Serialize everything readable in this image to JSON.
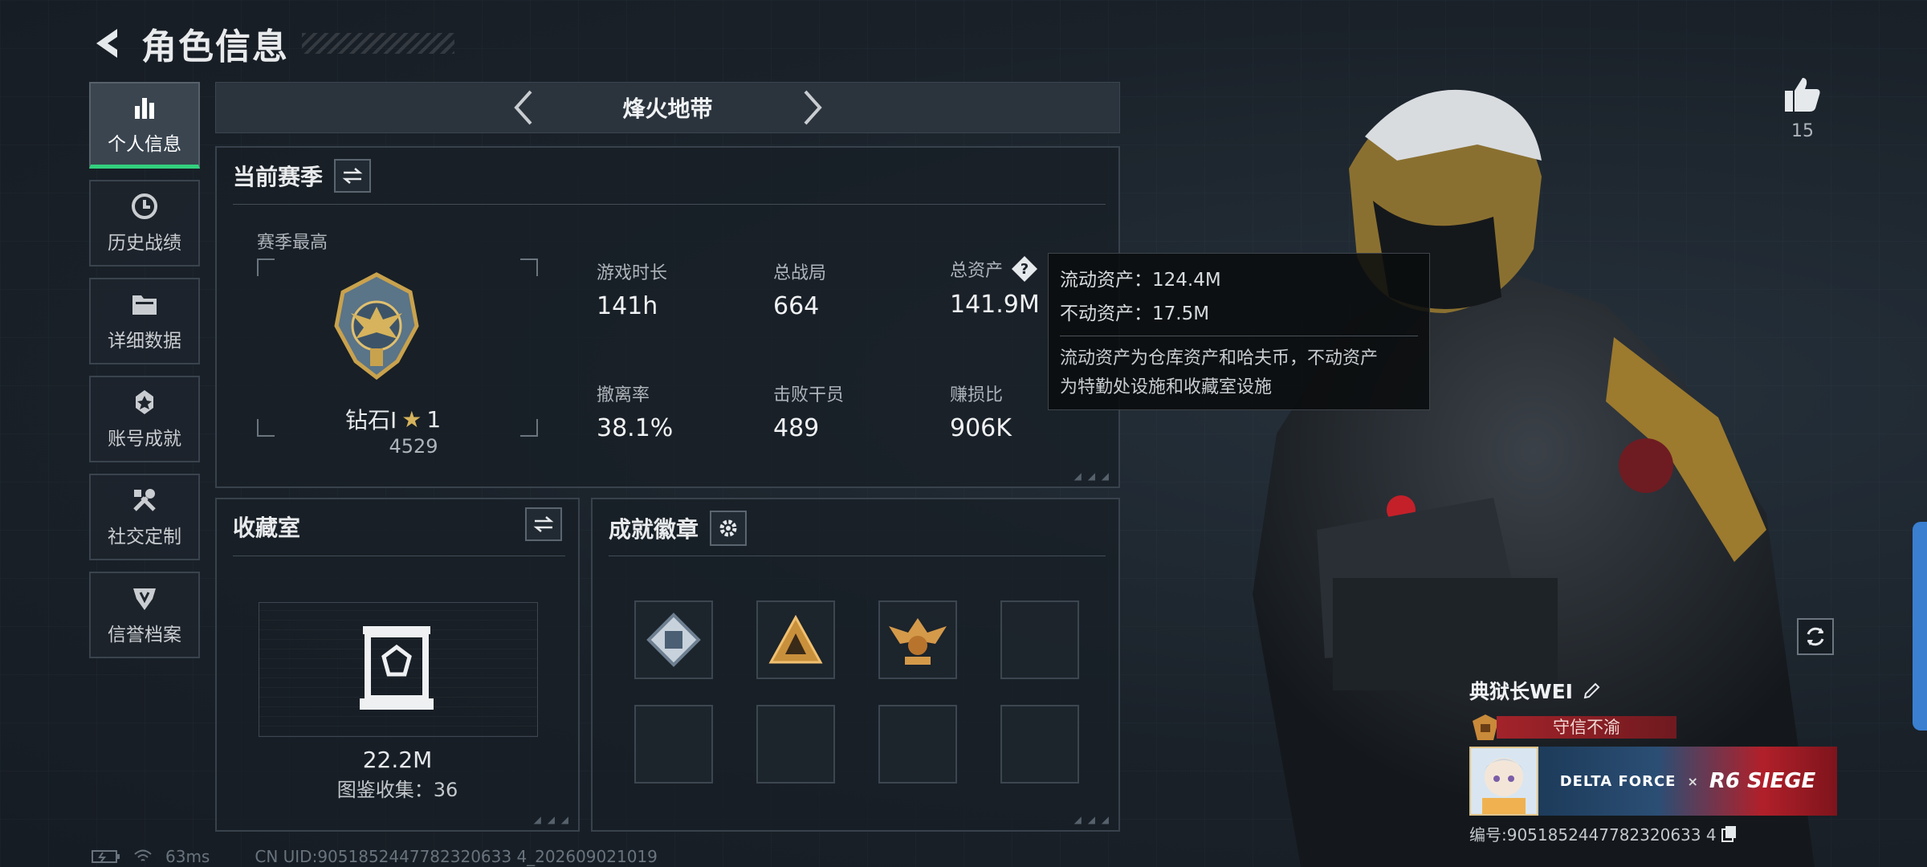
{
  "header": {
    "title": "角色信息"
  },
  "nav": {
    "items": [
      {
        "label": "个人信息",
        "icon": "bar-chart-icon",
        "active": true
      },
      {
        "label": "历史战绩",
        "icon": "history-clock-icon",
        "active": false
      },
      {
        "label": "详细数据",
        "icon": "folder-icon",
        "active": false
      },
      {
        "label": "账号成就",
        "icon": "achievement-icon",
        "active": false
      },
      {
        "label": "社交定制",
        "icon": "tools-icon",
        "active": false
      },
      {
        "label": "信誉档案",
        "icon": "shield-badge-icon",
        "active": false
      }
    ]
  },
  "mode": {
    "title": "烽火地带"
  },
  "season": {
    "title": "当前赛季",
    "best_label": "赛季最高",
    "rank_name": "钻石Ⅰ",
    "rank_stars": "1",
    "rank_score": "4529",
    "stats": [
      {
        "label": "游戏时长",
        "value": "141h"
      },
      {
        "label": "总战局",
        "value": "664"
      },
      {
        "label": "总资产",
        "value": "141.9M",
        "help": true
      },
      {
        "label": "撤离率",
        "value": "38.1%"
      },
      {
        "label": "击败干员",
        "value": "489"
      },
      {
        "label": "赚损比",
        "value": "906K"
      }
    ]
  },
  "tooltip": {
    "liquid": "流动资产：124.4M",
    "fixed": "不动资产：17.5M",
    "desc_line1": "流动资产为仓库资产和哈夫币，不动资产",
    "desc_line2": "为特勤处设施和收藏室设施"
  },
  "collection": {
    "title": "收藏室",
    "value": "22.2M",
    "count_text": "图鉴收集：36"
  },
  "badges": {
    "title": "成就徽章",
    "slots": [
      "diamond-badge-icon",
      "triangle-badge-icon",
      "eagle-badge-icon",
      "",
      "",
      "",
      "",
      ""
    ]
  },
  "profile": {
    "likes": "15",
    "name": "典狱长WEI",
    "title_plate": "守信不渝",
    "banner_brand": "DELTA FORCE",
    "banner_cross": "×",
    "banner_collab": "R6 SIEGE",
    "id_text": "编号:9051852447782320633 4"
  },
  "footer": {
    "ping": "63ms",
    "uid": "CN UID:9051852447782320633 4_202609021019"
  },
  "colors": {
    "accent_green": "#32d07e",
    "title_red": "#a3232a",
    "panel_border": "#38424c"
  }
}
